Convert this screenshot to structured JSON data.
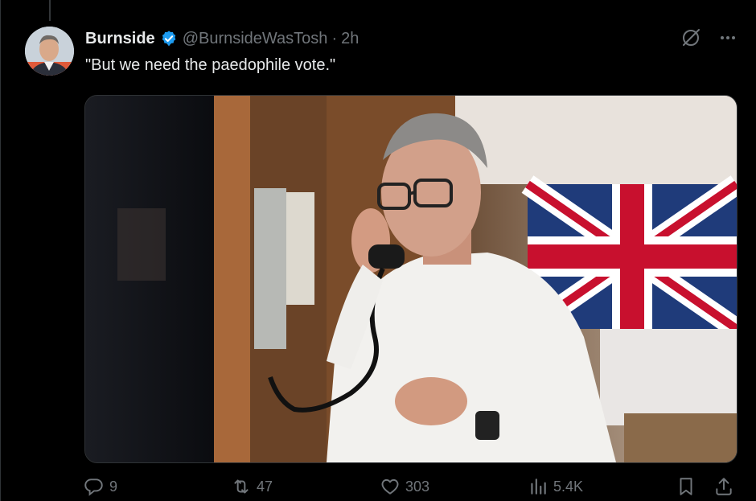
{
  "post": {
    "author_name": "Burnside",
    "handle": "@BurnsideWasTosh",
    "separator": "·",
    "time": "2h",
    "text": "\"But we need the paedophile vote.\""
  },
  "media": {
    "alt": "Man in white shirt on wall telephone beside Union flag"
  },
  "actions": {
    "replies": "9",
    "reposts": "47",
    "likes": "303",
    "views": "5.4K"
  },
  "icons": {
    "verified": "verified-badge-icon",
    "grok": "grok-icon",
    "more": "more-icon",
    "reply": "reply-icon",
    "repost": "repost-icon",
    "like": "like-icon",
    "views": "views-icon",
    "bookmark": "bookmark-icon",
    "share": "share-icon"
  },
  "colors": {
    "background": "#000000",
    "text": "#e7e9ea",
    "secondary": "#71767b",
    "verified": "#1d9bf0"
  }
}
